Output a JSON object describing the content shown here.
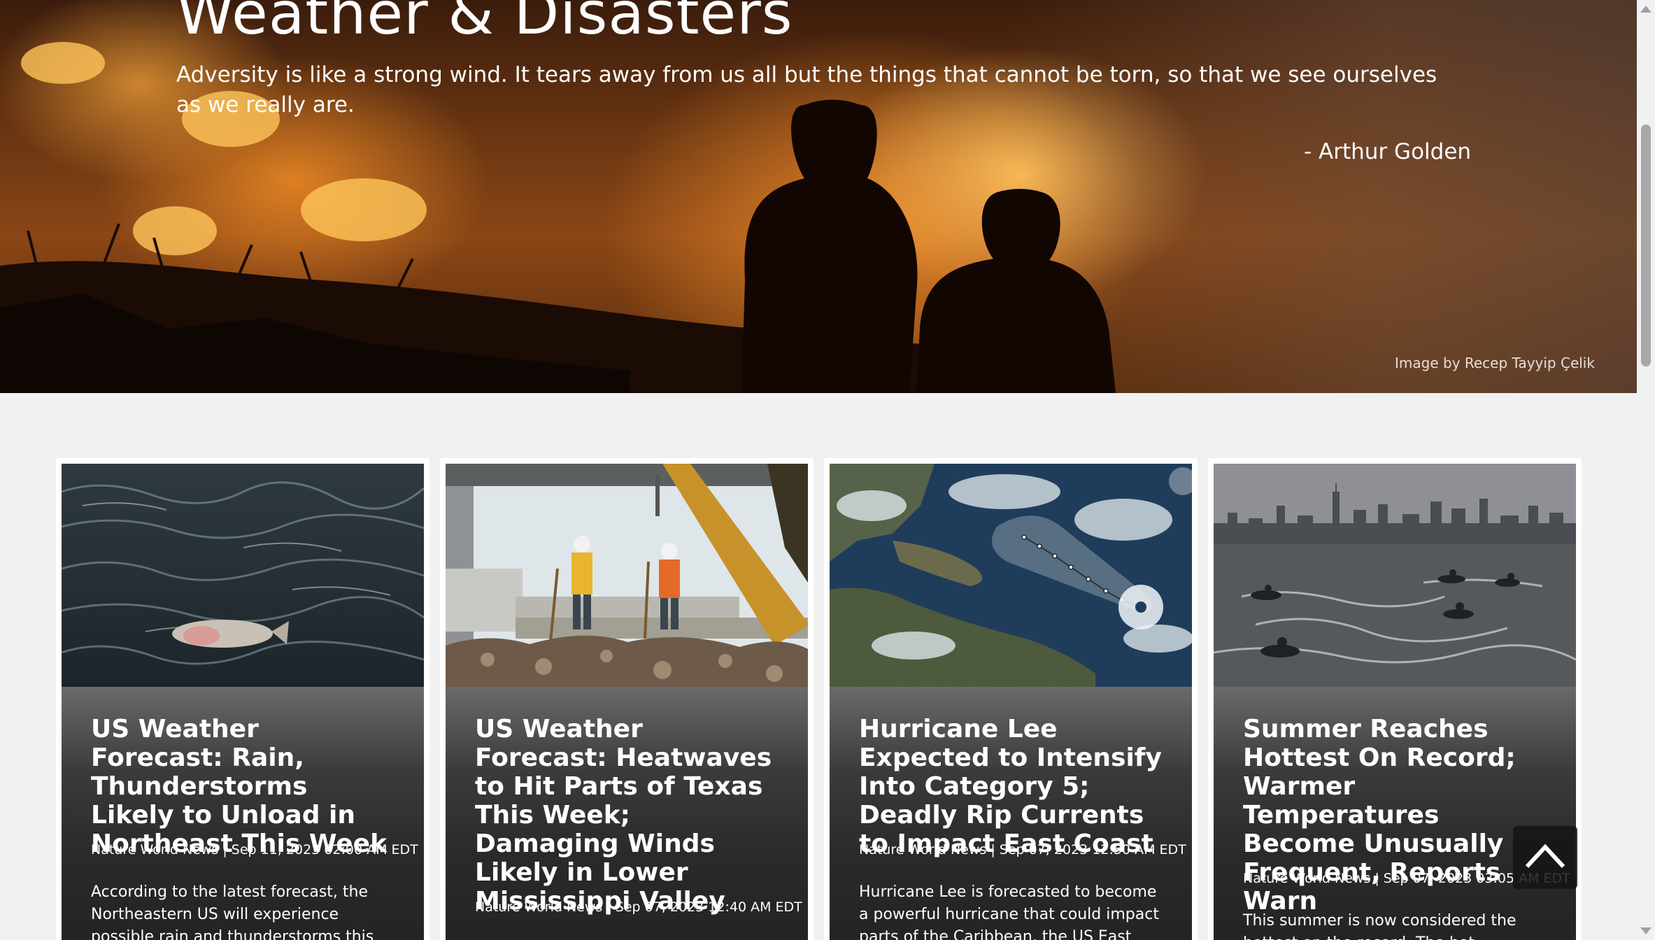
{
  "hero": {
    "title": "Weather & Disasters",
    "quote": "Adversity is like a strong wind. It tears away from us all but the things that cannot be torn, so that we see ourselves as we really are.",
    "author": "- Arthur Golden",
    "image_credit": "Image by Recep Tayyip Çelik"
  },
  "articles": [
    {
      "title": "US Weather Forecast: Rain, Thunderstorms Likely to Unload in Northeast This Week",
      "meta": "Nature World News | Sep 11, 2023 02:00 AM EDT",
      "excerpt": "According to the latest forecast, the Northeastern US will experience possible rain and thunderstorms this week due",
      "image": "fish-in-water"
    },
    {
      "title": "US Weather Forecast: Heatwaves to Hit Parts of Texas This Week; Damaging Winds Likely in Lower Mississippi Valley",
      "meta": "Nature World News | Sep 07, 2023 12:40 AM EDT",
      "excerpt": "",
      "image": "construction-workers"
    },
    {
      "title": "Hurricane Lee Expected to Intensify Into Category 5; Deadly Rip Currents to Impact East Coast",
      "meta": "Nature World News | Sep 07, 2023 12:50 AM EDT",
      "excerpt": "Hurricane Lee is forecasted to become a powerful hurricane that could impact parts of the Caribbean, the US East",
      "image": "hurricane-satellite-map"
    },
    {
      "title": "Summer Reaches Hottest On Record; Warmer Temperatures Become Unusually Frequent, Reports Warn",
      "meta": "Nature World News | Sep 07, 2023 03:05 AM EDT",
      "excerpt": "This summer is now considered the hottest on the record. The hot",
      "image": "jet-skis-city-skyline"
    }
  ],
  "icons": {
    "back_to_top": "chevron-up-icon"
  },
  "colors": {
    "page_background": "#f1f1f1",
    "card_text": "#ffffff",
    "hero_fire": "#e8842a"
  }
}
